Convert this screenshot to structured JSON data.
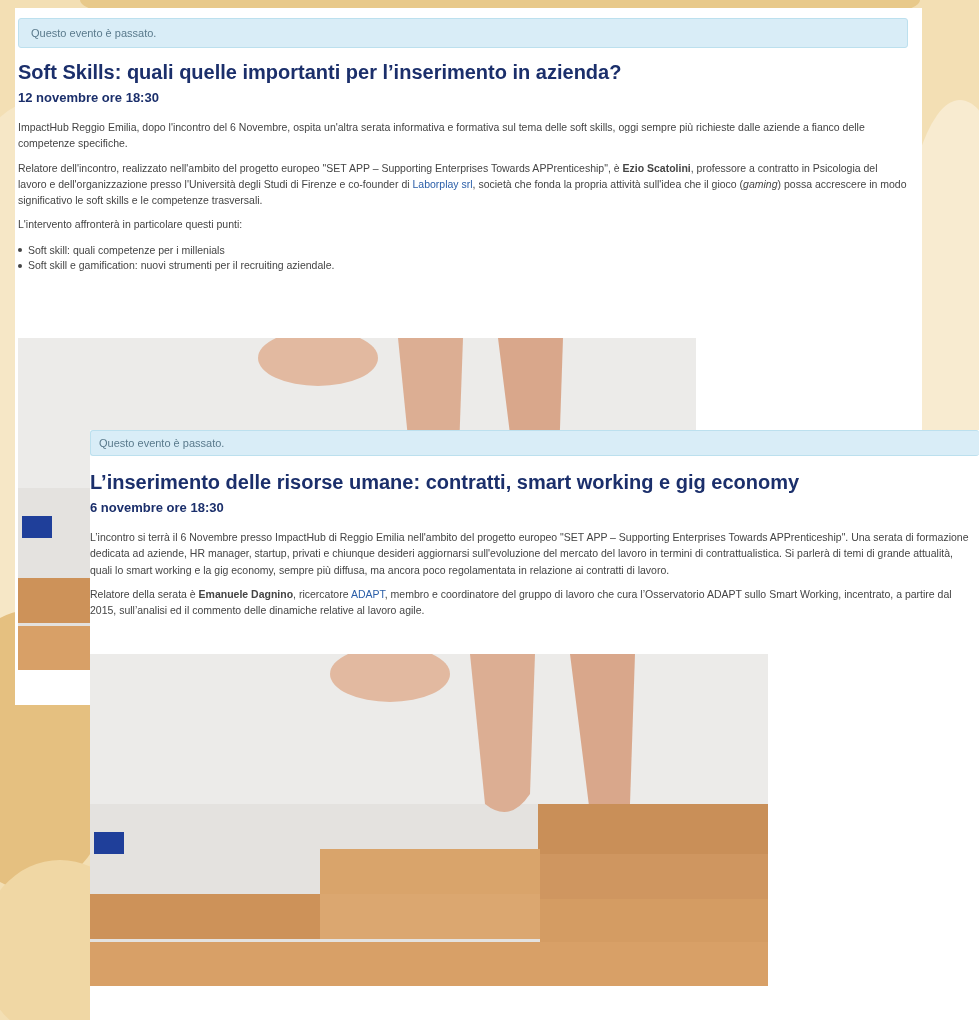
{
  "events": [
    {
      "notice": "Questo evento è passato.",
      "title": "Soft Skills: quali quelle importanti per l’inserimento in azienda?",
      "date": "12 novembre ore 18:30",
      "paragraphs": [
        [
          {
            "kind": "text",
            "text": "ImpactHub Reggio Emilia, dopo l'incontro del 6 Novembre, ospita un'altra serata informativa e formativa sul tema delle soft skills, oggi sempre più richieste dalle aziende a fianco delle competenze specifiche."
          }
        ],
        [
          {
            "kind": "text",
            "text": "Relatore dell'incontro, realizzato nell'ambito del progetto europeo \"SET APP – Supporting Enterprises Towards APPrenticeship\", è **Ezio Scatolini**, professore a contratto in Psicologia del lavoro e dell'organizzazione presso l'Università degli Studi di Firenze e co-founder di "
          },
          {
            "kind": "link",
            "text": "Laborplay srl"
          },
          {
            "kind": "text",
            "text": ", società che fonda la propria attività sull'idea che il gioco (*gaming*) possa accrescere in modo significativo le soft skills e le competenze trasversali."
          }
        ],
        [
          {
            "kind": "text",
            "text": "L'intervento affronterà in particolare questi punti:"
          }
        ]
      ],
      "bullets": [
        "Soft skill: quali competenze per i millenials",
        "Soft skill e gamification: nuovi strumenti per il recruiting aziendale."
      ],
      "image": {
        "kind": "picture"
      }
    },
    {
      "notice": "Questo evento è passato.",
      "title": "L’inserimento delle risorse umane: contratti, smart working e gig economy",
      "date": "6 novembre ore 18:30",
      "paragraphs": [
        [
          {
            "kind": "text",
            "text": "L’incontro si terrà il 6 Novembre presso ImpactHub di Reggio Emilia nell'ambito del progetto europeo \"SET APP – Supporting Enterprises Towards APPrenticeship\". Una serata di formazione dedicata ad aziende, HR manager, startup, privati e chiunque desideri aggiornarsi sull'evoluzione del mercato del lavoro in termini di contrattualistica. Si parlerà di temi di grande attualità, quali lo smart working e la gig economy, sempre più diffusa, ma ancora poco regolamentata in relazione ai contratti di lavoro."
          }
        ],
        [
          {
            "kind": "text",
            "text": "Relatore della serata è **Emanuele Dagnino**, ricercatore "
          },
          {
            "kind": "link",
            "text": "ADAPT"
          },
          {
            "kind": "text",
            "text": ", membro e coordinatore del gruppo di lavoro che cura l’Osservatorio ADAPT sullo Smart Working, incentrato, a partire dal 2015, sull’analisi ed il commento delle dinamiche relative al lavoro agile."
          }
        ]
      ],
      "image": {
        "kind": "picture"
      }
    }
  ]
}
